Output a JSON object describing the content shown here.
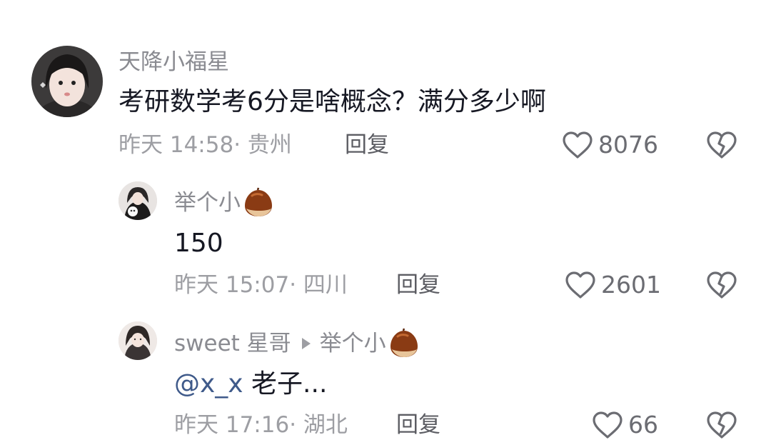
{
  "comments": [
    {
      "username": "天降小福星",
      "text": "考研数学考6分是啥概念？满分多少啊",
      "time": "昨天 14:58",
      "location": "贵州",
      "reply_label": "回复",
      "likes": "8076"
    },
    {
      "username": "举个小",
      "text": "150",
      "time": "昨天 15:07",
      "location": "四川",
      "reply_label": "回复",
      "likes": "2601"
    },
    {
      "username": "sweet 星哥",
      "reply_to": "举个小",
      "mention": "@x_x",
      "text": " 老子...",
      "time": "昨天 17:16",
      "location": "湖北",
      "reply_label": "回复",
      "likes": "66"
    }
  ],
  "meta_separator": "· ",
  "icons": {
    "like": "heart-outline-icon",
    "dislike": "broken-heart-icon",
    "reply_arrow": "triangle-right-icon",
    "name_emoji": "chestnut-icon"
  },
  "colors": {
    "name": "#8a8b91",
    "text": "#161823",
    "meta": "#9d9ea3",
    "mention": "#3f5a8a"
  }
}
